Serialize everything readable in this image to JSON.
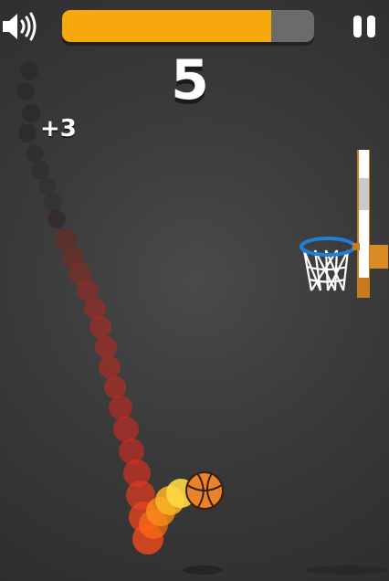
{
  "hud": {
    "sound_icon": "speaker-volume-icon",
    "pause_icon": "pause-icon",
    "progress": 0.83,
    "progress_color": "#f6a90c",
    "track_color": "#6b6b6b"
  },
  "score": "5",
  "bonus": "+3",
  "colors": {
    "background": "#3b3b3b",
    "rim": "#1e7fd6",
    "backboard": "#c77a1e",
    "ball": "#e8842a",
    "trail_fire": "#ff3b1a"
  }
}
